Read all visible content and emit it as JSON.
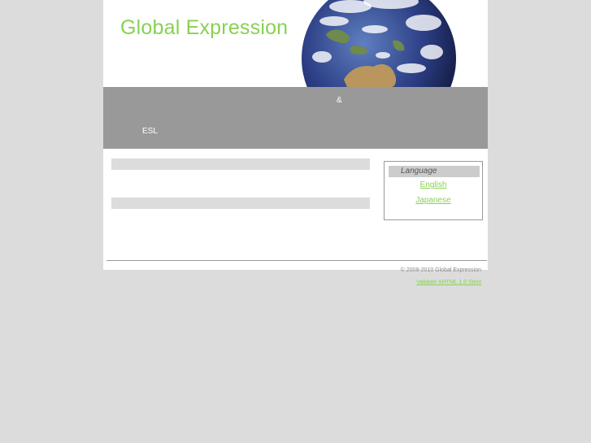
{
  "header": {
    "site_title": "Global Expression",
    "title_color": "#88d151"
  },
  "banner": {
    "ampersand": "&",
    "esl": "ESL",
    "color": "#999999"
  },
  "sidebar": {
    "language_heading": "Language",
    "languages": [
      {
        "label": "English"
      },
      {
        "label": "Japanese"
      }
    ]
  },
  "footer": {
    "copyright": "© 2008-2010 Global Expression",
    "validate_link": "Validate XHTML 1.0 Strict"
  },
  "icons": [
    "globe-image"
  ]
}
